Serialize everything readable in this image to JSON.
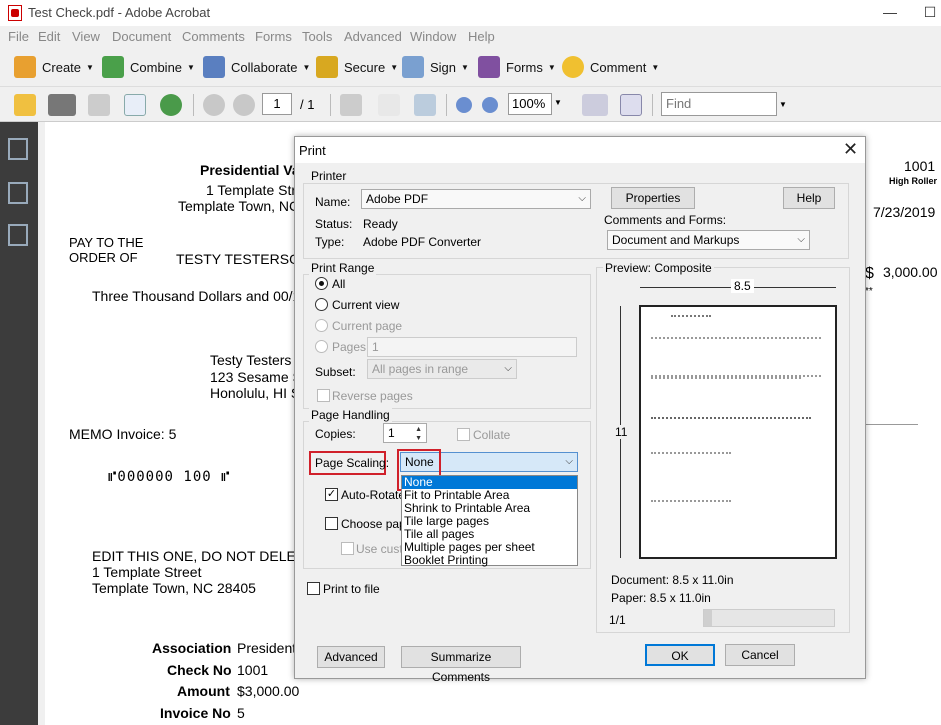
{
  "window": {
    "title": "Test Check.pdf - Adobe Acrobat"
  },
  "menu": [
    "File",
    "Edit",
    "View",
    "Document",
    "Comments",
    "Forms",
    "Tools",
    "Advanced",
    "Window",
    "Help"
  ],
  "toolbar": {
    "create": "Create",
    "combine": "Combine",
    "collaborate": "Collaborate",
    "secure": "Secure",
    "sign": "Sign",
    "forms": "Forms",
    "comment": "Comment"
  },
  "nav": {
    "page": "1",
    "of": "/ 1",
    "zoom": "100%",
    "find_placeholder": "Find"
  },
  "doc": {
    "company": "Presidential Va",
    "addr1": "1 Template Str",
    "addr2": "Template Town, NC",
    "check_no": "1001",
    "bank": "High Roller",
    "date": "7/23/2019",
    "pay_to": "PAY TO THE",
    "order_of": "ORDER OF",
    "payee": "TESTY TESTERSO",
    "amount_words": "Three Thousand Dollars and 00/1",
    "dollar": "$",
    "amount": "3,000.00",
    "stars": "**",
    "p_name": "Testy Testers",
    "p_addr1": "123 Sesame S",
    "p_addr2": "Honolulu, HI S",
    "memo": "MEMO   Invoice: 5",
    "micr": "⑈000000 100 ⑈",
    "stub_name": "EDIT THIS ONE, DO NOT DELE",
    "stub_addr1": "1 Template Street",
    "stub_addr2": "Template Town, NC 28405",
    "k_assoc": "Association",
    "v_assoc": "President",
    "k_check": "Check No",
    "v_check": "1001",
    "k_amount": "Amount",
    "v_amount": "$3,000.00",
    "k_invoice": "Invoice No",
    "v_invoice": "5"
  },
  "dialog": {
    "title": "Print",
    "printer_legend": "Printer",
    "name_label": "Name:",
    "name_value": "Adobe PDF",
    "properties": "Properties",
    "help": "Help",
    "status_label": "Status:",
    "status_value": "Ready",
    "type_label": "Type:",
    "type_value": "Adobe PDF Converter",
    "comments_forms_label": "Comments and Forms:",
    "comments_forms_value": "Document and Markups",
    "range_legend": "Print Range",
    "all": "All",
    "current_view": "Current view",
    "current_page": "Current page",
    "pages": "Pages",
    "pages_value": "1",
    "subset_label": "Subset:",
    "subset_value": "All pages in range",
    "reverse": "Reverse pages",
    "handling_legend": "Page Handling",
    "copies_label": "Copies:",
    "copies_value": "1",
    "collate": "Collate",
    "scaling_label": "Page Scaling:",
    "scaling_value": "None",
    "scaling_options": [
      "None",
      "Fit to Printable Area",
      "Shrink to Printable Area",
      "Tile large pages",
      "Tile all pages",
      "Multiple pages per sheet",
      "Booklet Printing"
    ],
    "auto_rotate": "Auto-Rotate",
    "choose_paper": "Choose pape",
    "use_custom": "Use custo",
    "print_to_file": "Print to file",
    "preview_legend": "Preview: Composite",
    "width": "8.5",
    "height": "11",
    "doc_size": "Document: 8.5 x 11.0in",
    "paper_size": "Paper: 8.5 x 11.0in",
    "page_count": "1/1",
    "advanced": "Advanced",
    "summarize": "Summarize Comments",
    "ok": "OK",
    "cancel": "Cancel"
  }
}
